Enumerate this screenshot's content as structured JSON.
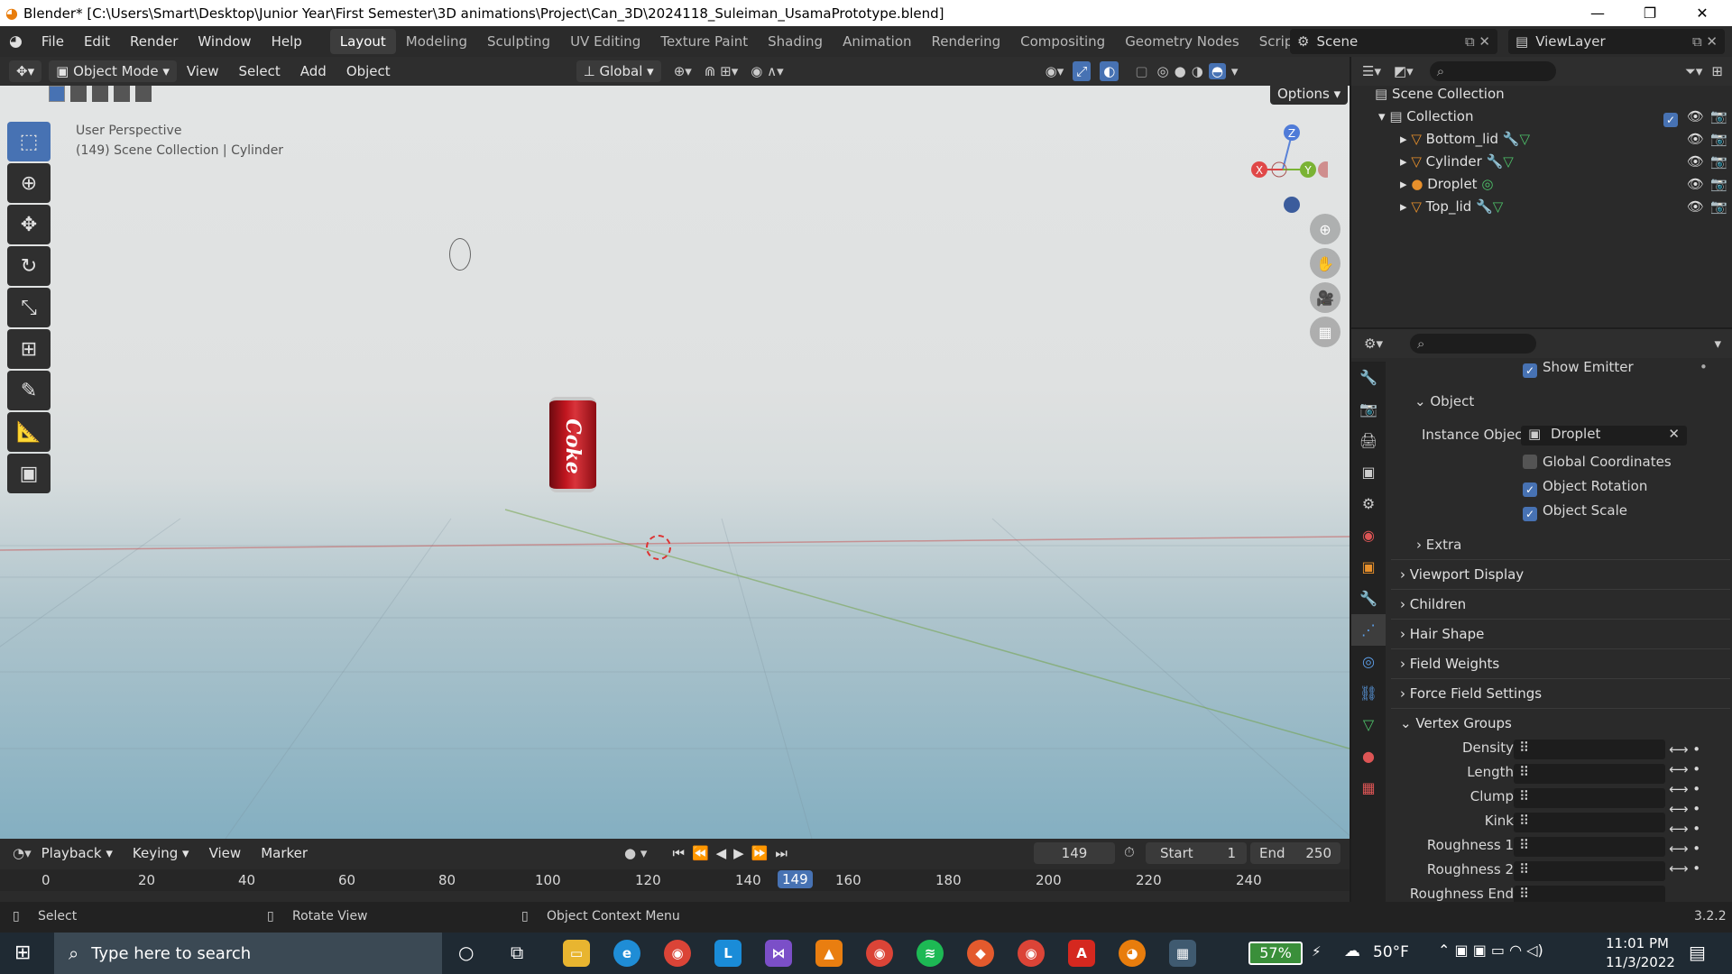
{
  "window": {
    "title": "Blender* [C:\\Users\\Smart\\Desktop\\Junior Year\\First Semester\\3D animations\\Project\\Can_3D\\2024118_Suleiman_UsamaPrototype.blend]",
    "minimize": "—",
    "maximize": "❐",
    "close": "✕"
  },
  "menu": [
    "File",
    "Edit",
    "Render",
    "Window",
    "Help"
  ],
  "workspaces": [
    "Layout",
    "Modeling",
    "Sculpting",
    "UV Editing",
    "Texture Paint",
    "Shading",
    "Animation",
    "Rendering",
    "Compositing",
    "Geometry Nodes",
    "Scripting"
  ],
  "add_workspace": "+",
  "scene": {
    "label": "Scene",
    "viewlayer": "ViewLayer"
  },
  "viewport_header": {
    "mode": "Object Mode",
    "menus": [
      "View",
      "Select",
      "Add",
      "Object"
    ],
    "orientation": "Global",
    "options": "Options"
  },
  "viewport": {
    "perspective": "User Perspective",
    "context": "(149) Scene Collection | Cylinder",
    "can_label": "Coke",
    "gizmo": {
      "z": "Z",
      "x": "X",
      "y": "Y"
    }
  },
  "outliner": {
    "root": "Scene Collection",
    "collection": "Collection",
    "items": [
      "Bottom_lid",
      "Cylinder",
      "Droplet",
      "Top_lid"
    ]
  },
  "properties": {
    "show_emitter": "Show Emitter",
    "object_panel": "Object",
    "instance_object_label": "Instance Object",
    "instance_object_value": "Droplet",
    "global_coordinates": "Global Coordinates",
    "object_rotation": "Object Rotation",
    "object_scale": "Object Scale",
    "extra": "Extra",
    "panels": [
      "Viewport Display",
      "Children",
      "Hair Shape",
      "Field Weights",
      "Force Field Settings"
    ],
    "vertex_groups": "Vertex Groups",
    "vg_rows": [
      "Density",
      "Length",
      "Clump",
      "Kink",
      "Roughness 1",
      "Roughness 2",
      "Roughness End"
    ]
  },
  "timeline": {
    "menus": [
      "Playback",
      "Keying",
      "View",
      "Marker"
    ],
    "current_frame": "149",
    "start_label": "Start",
    "start_value": "1",
    "end_label": "End",
    "end_value": "250",
    "ticks": [
      "0",
      "20",
      "40",
      "60",
      "80",
      "100",
      "120",
      "140",
      "160",
      "180",
      "200",
      "220",
      "240"
    ],
    "playhead": "149"
  },
  "statusbar": {
    "select": "Select",
    "rotate": "Rotate View",
    "context": "Object Context Menu",
    "version": "3.2.2"
  },
  "taskbar": {
    "search_placeholder": "Type here to search",
    "battery": "57%",
    "weather": "50°F",
    "time": "11:01 PM",
    "date": "11/3/2022"
  },
  "colors": {
    "accent": "#4772b3",
    "coke_red": "#b0141c",
    "sky": "#e1e3e3",
    "ground": "#84afc1"
  }
}
